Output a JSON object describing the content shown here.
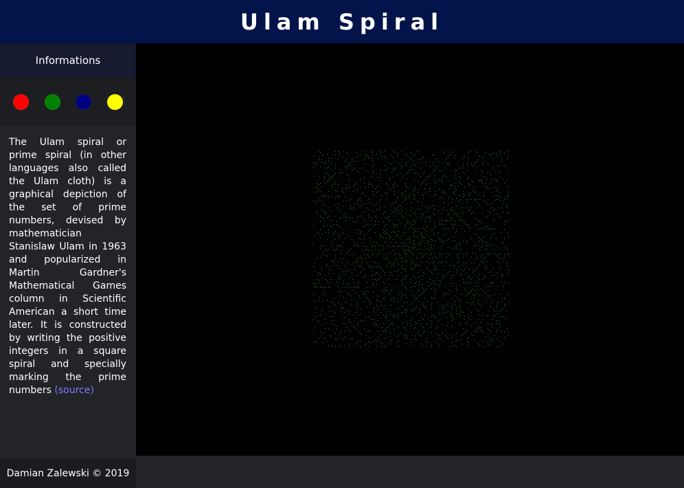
{
  "header": {
    "title": "Ulam Spiral"
  },
  "sidebar": {
    "title": "Informations",
    "colors": [
      {
        "name": "red",
        "hex": "#ff0000"
      },
      {
        "name": "green",
        "hex": "#008000"
      },
      {
        "name": "blue",
        "hex": "#000080"
      },
      {
        "name": "yellow",
        "hex": "#ffff00"
      }
    ],
    "description": "The Ulam spiral or prime spiral (in other languages also called the Ulam cloth) is a graphical depiction of the set of prime numbers, devised by mathematician Stanislaw Ulam in 1963 and popularized in Martin Gardner's Mathematical Games column in Scientific American a short time later. It is constructed by writing the positive integers in a square spiral and specially marking the prime numbers",
    "source_link": "(source)"
  },
  "canvas": {
    "point_color": "#2e8b2e",
    "background": "#000000"
  },
  "footer": {
    "copyright": "Damian Zalewski © 2019"
  }
}
